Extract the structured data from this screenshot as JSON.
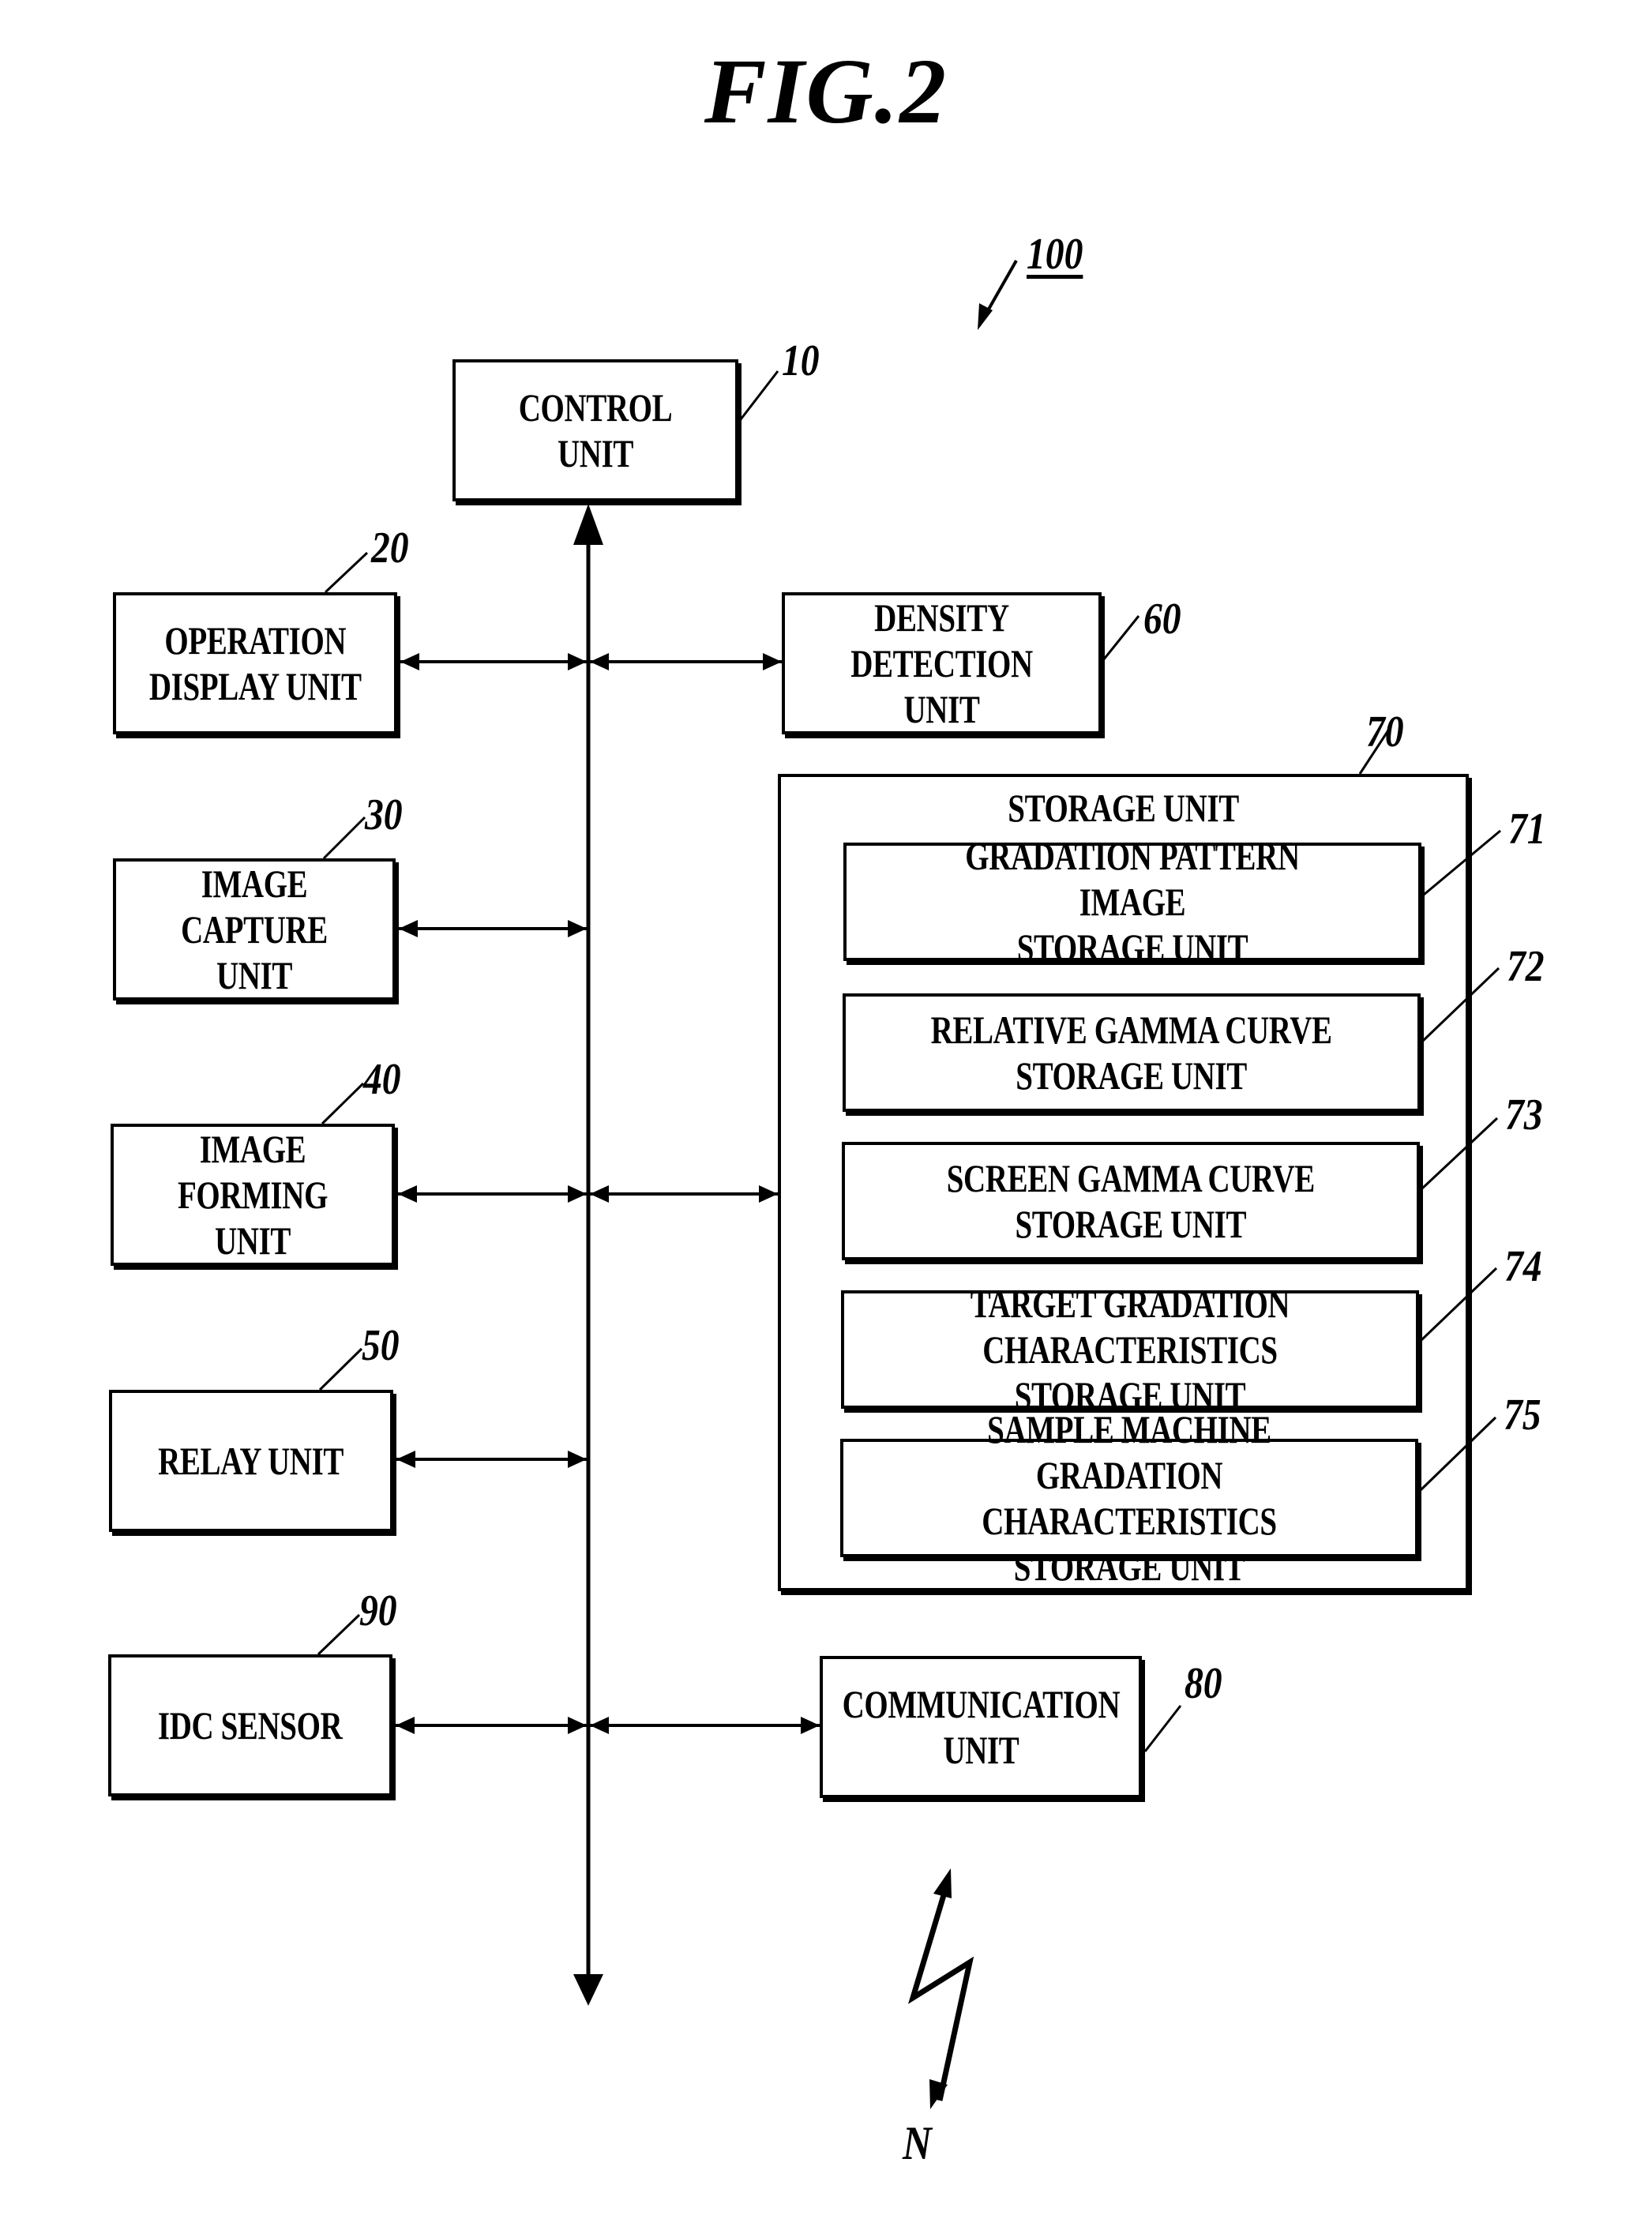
{
  "figure": {
    "title": "FIG.2",
    "system_ref": "100",
    "network_label": "N"
  },
  "units": {
    "control": {
      "label": "CONTROL UNIT",
      "ref": "10"
    },
    "operation_display": {
      "label": "OPERATION\nDISPLAY UNIT",
      "ref": "20"
    },
    "image_capture": {
      "label": "IMAGE\nCAPTURE UNIT",
      "ref": "30"
    },
    "image_forming": {
      "label": "IMAGE\nFORMING UNIT",
      "ref": "40"
    },
    "relay": {
      "label": "RELAY UNIT",
      "ref": "50"
    },
    "idc_sensor": {
      "label": "IDC SENSOR",
      "ref": "90"
    },
    "density_detection": {
      "label": "DENSITY\nDETECTION UNIT",
      "ref": "60"
    },
    "communication": {
      "label": "COMMUNICATION\nUNIT",
      "ref": "80"
    },
    "storage": {
      "label": "STORAGE UNIT",
      "ref": "70",
      "sub_units": [
        {
          "label": "GRADATION PATTERN IMAGE\nSTORAGE UNIT",
          "ref": "71"
        },
        {
          "label": "RELATIVE GAMMA CURVE\nSTORAGE UNIT",
          "ref": "72"
        },
        {
          "label": "SCREEN GAMMA CURVE\nSTORAGE UNIT",
          "ref": "73"
        },
        {
          "label": "TARGET GRADATION\nCHARACTERISTICS STORAGE UNIT",
          "ref": "74"
        },
        {
          "label": "SAMPLE MACHINE GRADATION\nCHARACTERISTICS STORAGE UNIT",
          "ref": "75"
        }
      ]
    }
  },
  "connections": [
    {
      "from": "bus",
      "to": "control",
      "type": "arrow-up"
    },
    {
      "from": "operation_display",
      "to": "bus",
      "type": "bidirectional"
    },
    {
      "from": "bus",
      "to": "density_detection",
      "type": "bidirectional"
    },
    {
      "from": "image_capture",
      "to": "bus",
      "type": "bidirectional"
    },
    {
      "from": "image_forming",
      "to": "bus",
      "type": "bidirectional"
    },
    {
      "from": "bus",
      "to": "storage",
      "type": "bidirectional"
    },
    {
      "from": "relay",
      "to": "bus",
      "type": "bidirectional"
    },
    {
      "from": "idc_sensor",
      "to": "bus",
      "type": "bidirectional"
    },
    {
      "from": "bus",
      "to": "communication",
      "type": "bidirectional"
    },
    {
      "from": "communication",
      "to": "network",
      "type": "wireless"
    }
  ]
}
